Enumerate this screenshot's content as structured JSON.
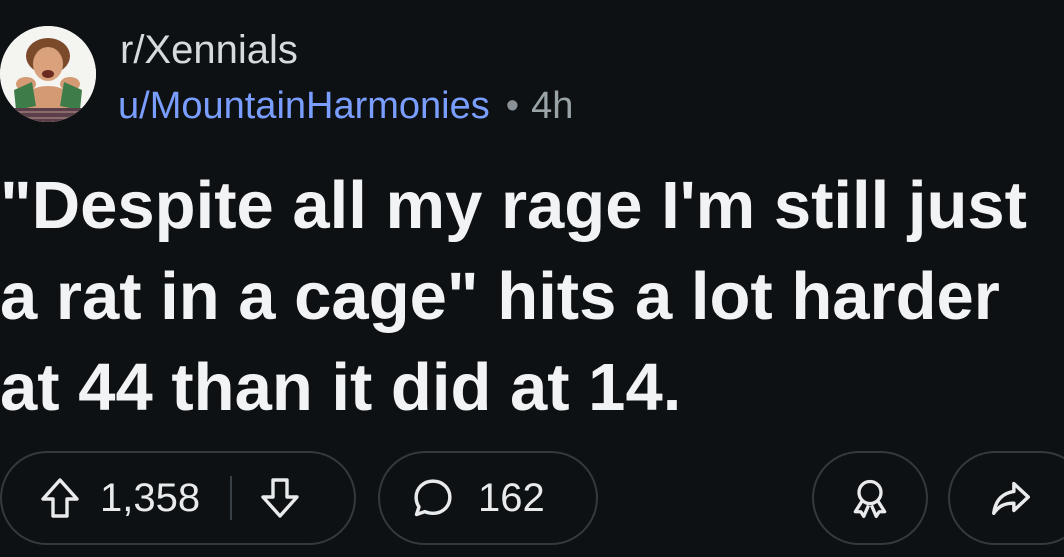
{
  "post": {
    "subreddit": "r/Xennials",
    "author": "u/MountainHarmonies",
    "separator": "•",
    "age": "4h",
    "title_lines": [
      "\"Despite all my rage I'm still just",
      "a rat in a cage\" hits a lot harder",
      "at 44 than it did at 14."
    ]
  },
  "actions": {
    "upvotes": "1,358",
    "comments": "162"
  },
  "icons": {
    "upvote": "arrow-up-icon",
    "downvote": "arrow-down-icon",
    "comment": "speech-bubble-icon",
    "award": "award-ribbon-icon",
    "share": "share-arrow-icon"
  },
  "colors": {
    "background": "#0e1113",
    "username": "#7a9eff",
    "text": "#f2f3f4",
    "pill_border": "#33393d"
  }
}
